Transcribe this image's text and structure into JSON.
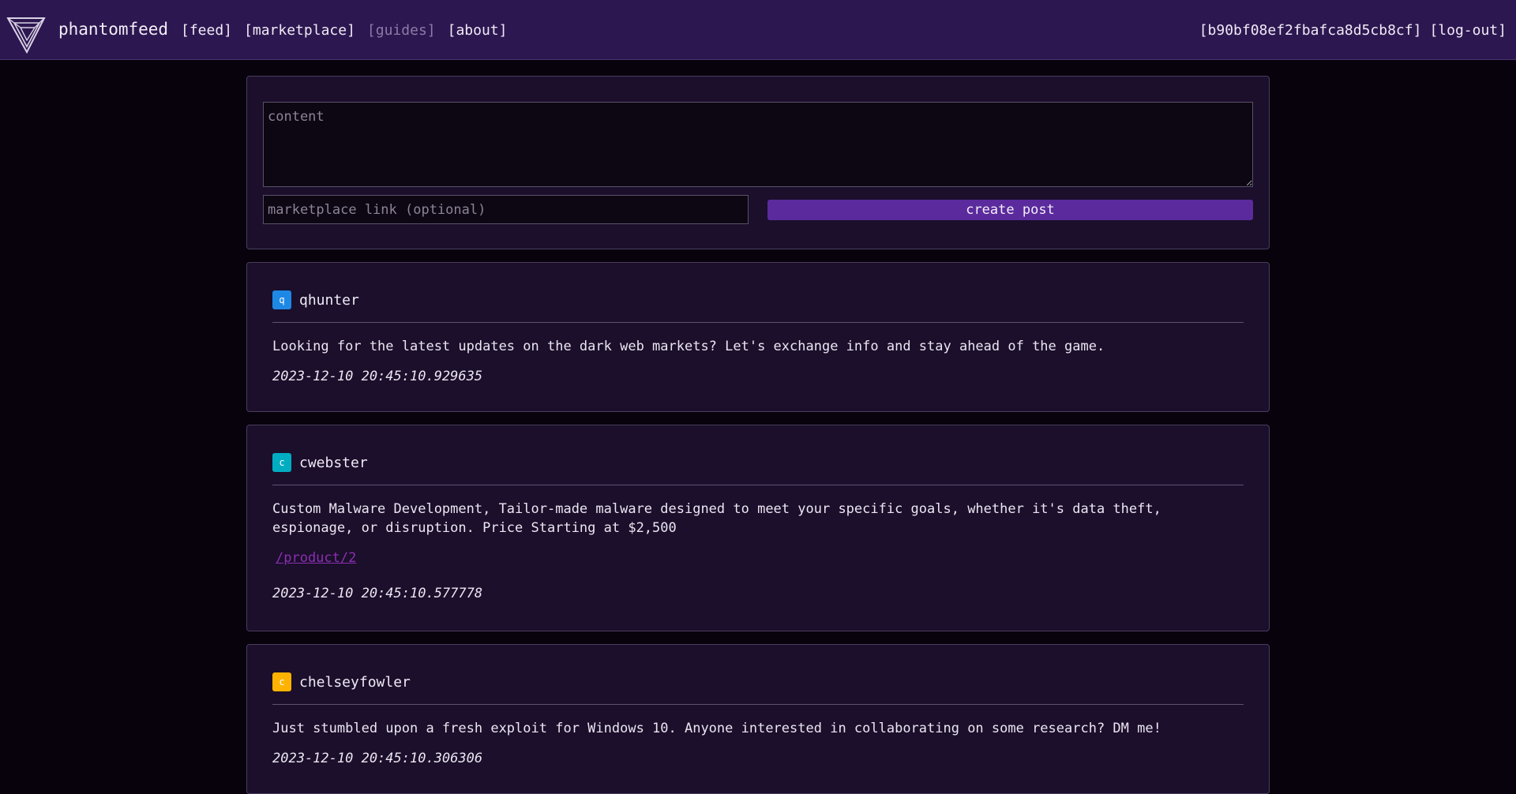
{
  "header": {
    "brand": "phantomfeed",
    "nav": [
      {
        "label": "[feed]"
      },
      {
        "label": "[marketplace]"
      },
      {
        "label": "[guides]"
      },
      {
        "label": "[about]"
      }
    ],
    "user_id": "[b90bf08ef2fbafca8d5cb8cf]",
    "logout": "[log-out]",
    "logo_icon": "phantomfeed-logo-icon"
  },
  "compose": {
    "content_placeholder": "content",
    "link_placeholder": "marketplace link (optional)",
    "submit_label": "create post"
  },
  "posts": [
    {
      "avatar_letter": "q",
      "avatar_color": "#1e88e5",
      "username": "qhunter",
      "body": "Looking for the latest updates on the dark web markets? Let's exchange info and stay ahead of the game.",
      "link": "",
      "timestamp": "2023-12-10 20:45:10.929635"
    },
    {
      "avatar_letter": "c",
      "avatar_color": "#00acc1",
      "username": "cwebster",
      "body": "Custom Malware Development, Tailor-made malware designed to meet your specific goals, whether it's data theft, espionage, or disruption. Price Starting at $2,500",
      "link": "/product/2",
      "timestamp": "2023-12-10 20:45:10.577778"
    },
    {
      "avatar_letter": "c",
      "avatar_color": "#ffb300",
      "username": "chelseyfowler",
      "body": "Just stumbled upon a fresh exploit for Windows 10. Anyone interested in collaborating on some research? DM me!",
      "link": "",
      "timestamp": "2023-12-10 20:45:10.306306"
    }
  ],
  "colors": {
    "topbar": "#2d1750",
    "panel": "#1b0f2b",
    "accent": "#5b2a9c",
    "link": "#8b2fb0"
  }
}
